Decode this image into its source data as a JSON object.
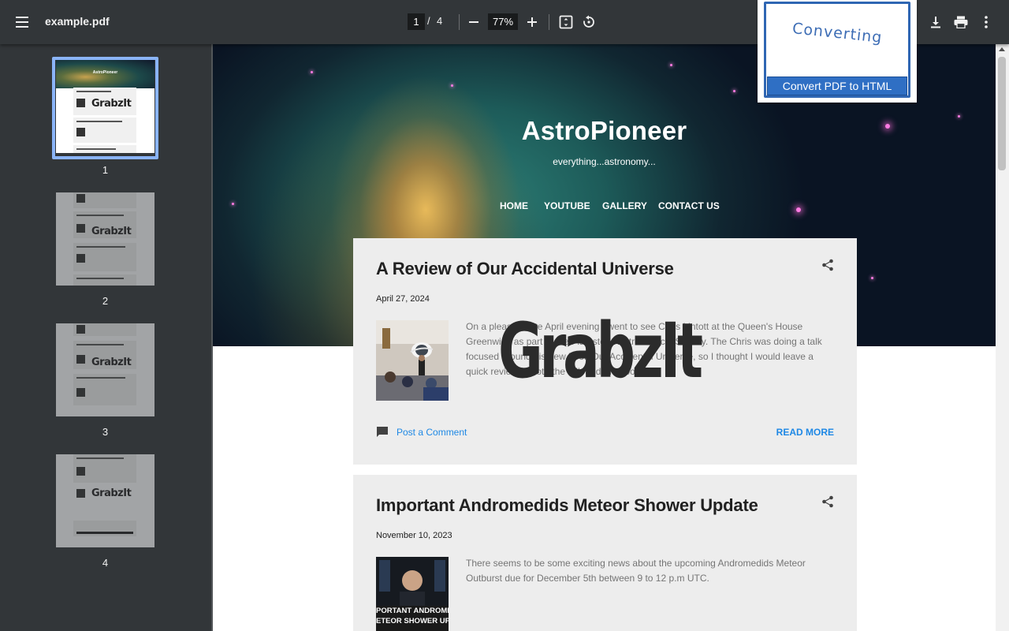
{
  "toolbar": {
    "file_title": "example.pdf",
    "current_page": "1",
    "page_separator": "/",
    "total_pages": "4",
    "zoom": "77%",
    "zoom_out_symbol": "−",
    "zoom_in_symbol": "+"
  },
  "sidebar": {
    "thumbnails": [
      {
        "label": "1",
        "selected": true
      },
      {
        "label": "2",
        "selected": false
      },
      {
        "label": "3",
        "selected": false
      },
      {
        "label": "4",
        "selected": false
      }
    ],
    "thumb_watermark": "GrabzIt",
    "thumb1_title": "AstroPioneer"
  },
  "blog": {
    "title": "AstroPioneer",
    "subtitle": "everything...astronomy...",
    "nav": [
      "HOME",
      "YOUTUBE",
      "GALLERY",
      "CONTACT US"
    ],
    "posts": [
      {
        "title": "A Review of Our Accidental Universe",
        "date": "April 27, 2024",
        "excerpt": "On a pleasant late April evening I went to see Chris Lintott at the Queen's House Greenwich as part of the Flamsteed Astronomical Society. The Chris was doing a talk focused around his new book Our Accidental Universe, so I thought I would leave a quick review of both the talk and the book.",
        "comment_label": "Post a Comment",
        "read_more": "READ MORE"
      },
      {
        "title": "Important Andromedids Meteor Shower Update",
        "date": "November 10, 2023",
        "excerpt": "There seems to be some exciting news about the upcoming Andromedids Meteor Outburst due for December 5th between 9 to 12 p.m UTC.",
        "image_caption_1": "PORTANT ANDROMEDI",
        "image_caption_2": "ETEOR SHOWER UPDAT"
      }
    ]
  },
  "watermark": "GrabzIt",
  "convert_popup": {
    "status": "Converting",
    "button_label": "Convert PDF to HTML"
  },
  "colors": {
    "toolbar_bg": "#323639",
    "viewer_bg": "#525659",
    "link_blue": "#1e88e5",
    "popup_blue": "#2f66b3",
    "thumb_selected": "#8ab4f8"
  }
}
